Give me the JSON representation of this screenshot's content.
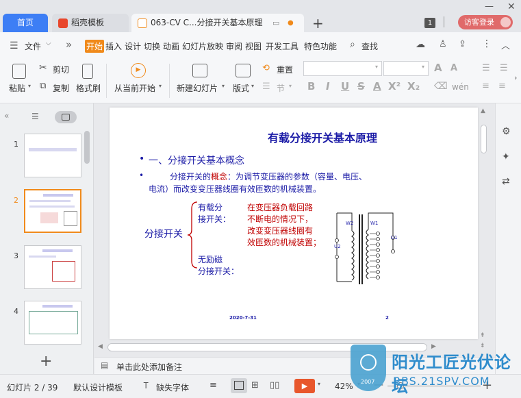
{
  "tabs": {
    "home": "首页",
    "template": "稻壳模板",
    "doc": "063-CV C...分接开关基本原理",
    "new_tab": "+"
  },
  "window": {
    "badge": "1",
    "login": "访客登录"
  },
  "menu": {
    "file": "文件",
    "items": [
      "开始",
      "插入",
      "设计",
      "切换",
      "动画",
      "幻灯片放映",
      "审阅",
      "视图",
      "开发工具",
      "特色功能"
    ],
    "search": "查找",
    "more": "»"
  },
  "ribbon": {
    "paste": "粘贴",
    "cut": "剪切",
    "copy": "复制",
    "format_painter": "格式刷",
    "from_current": "从当前开始",
    "new_slide": "新建幻灯片",
    "layout": "版式",
    "section": "节",
    "reset": "重置",
    "font_size_a": "A",
    "font_size_b": "A",
    "bold": "B",
    "italic": "I",
    "underline": "U",
    "strike": "S",
    "bottom_text": "wén"
  },
  "slides": {
    "numbers": [
      "1",
      "2",
      "3",
      "4"
    ],
    "add": "+"
  },
  "slide": {
    "title": "有载分接开关基本原理",
    "bullet1": "一、分接开关基本概念",
    "bullet2_prefix": "分接开关的",
    "bullet2_key": "概念",
    "bullet2_rest": "：为调节变压器的参数（容量、电压、",
    "bullet2_line2": "电流）而改变变压器线圈有效匝数的机械装置。",
    "switch_label": "分接开关",
    "onload_1": "有载分",
    "onload_2": "接开关：",
    "onload_desc_1": "在变压器负载回路",
    "onload_desc_2": "不断电的情况下，",
    "onload_desc_3": "改变变压器线圈有",
    "onload_desc_4": "效匝数的机械装置；",
    "offload_1": "无励磁",
    "offload_2": "分接开关：",
    "date": "2020-7-31",
    "page": "2",
    "coil_w2": "W2",
    "coil_w1": "W1",
    "coil_u2": "U2",
    "coil_u1": "U1"
  },
  "notes": {
    "placeholder": "单击此处添加备注"
  },
  "status": {
    "slide_info": "幻灯片 2 / 39",
    "theme": "默认设计模板",
    "missing_font": "缺失字体",
    "zoom": "42%",
    "watermark_main": "阳光工匠光伏论坛",
    "watermark_url": "BBS.21SPV.COM",
    "watermark_year": "2007"
  },
  "colors": {
    "accent": "#3d7ef5",
    "orange": "#f08a1b",
    "slide_blue": "#1a1aa6",
    "slide_red": "#c00000"
  }
}
